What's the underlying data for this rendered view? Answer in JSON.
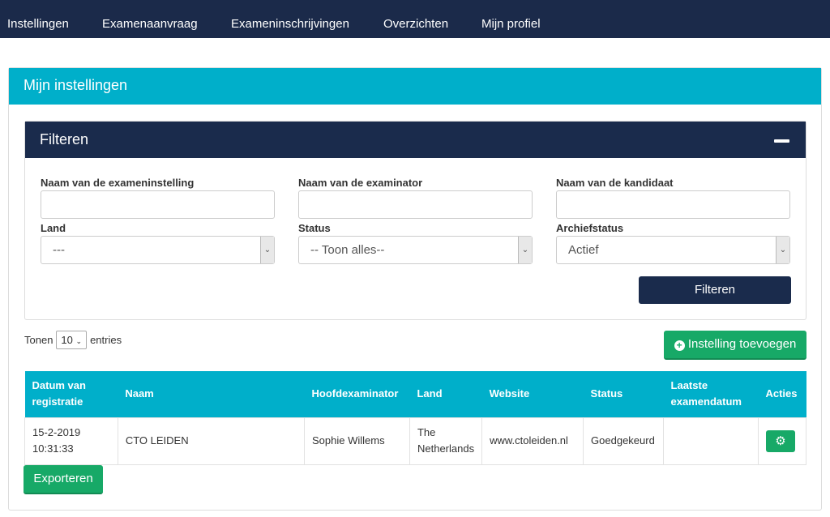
{
  "nav": [
    "Instellingen",
    "Examenaanvraag",
    "Exameninschrijvingen",
    "Overzichten",
    "Mijn profiel"
  ],
  "panel_title": "Mijn instellingen",
  "filter": {
    "title": "Filteren",
    "fields": [
      {
        "label": "Naam van de exameninstelling",
        "value": ""
      },
      {
        "label": "Naam van de examinator",
        "value": ""
      },
      {
        "label": "Naam van de kandidaat",
        "value": ""
      }
    ],
    "selects": [
      {
        "label": "Land",
        "value": "---"
      },
      {
        "label": "Status",
        "value": "-- Toon alles--"
      },
      {
        "label": "Archiefstatus",
        "value": "Actief"
      }
    ],
    "button": "Filteren"
  },
  "length": {
    "prefix": "Tonen",
    "value": "10",
    "suffix": "entries"
  },
  "add_button": "Instelling toevoegen",
  "table": {
    "headers": [
      "Datum van registratie",
      "Naam",
      "Hoofdexaminator",
      "Land",
      "Website",
      "Status",
      "Laatste examendatum",
      "Acties"
    ],
    "rows": [
      [
        "15-2-2019 10:31:33",
        "CTO LEIDEN",
        "Sophie Willems",
        "The Netherlands",
        "www.ctoleiden.nl",
        "Goedgekeurd",
        ""
      ]
    ]
  },
  "export_button": "Exporteren",
  "colors": {
    "nav": "#1b2a4a",
    "accent": "#00afca",
    "green": "#17a967"
  }
}
